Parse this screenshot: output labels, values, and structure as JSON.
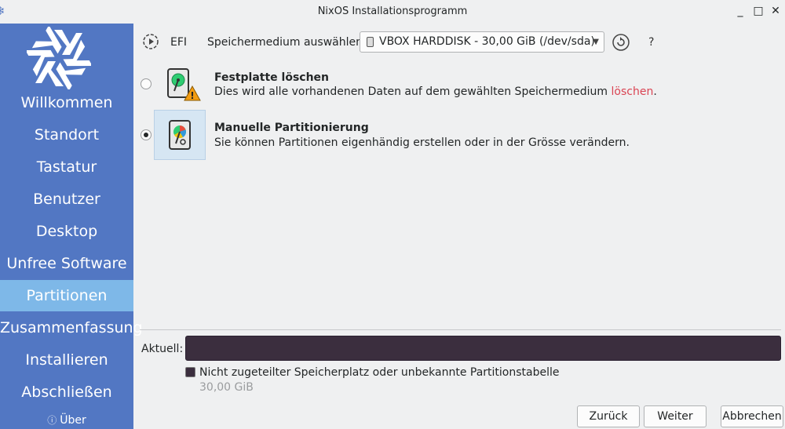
{
  "window": {
    "title": "NixOS Installationsprogramm",
    "minimize": "_",
    "maximize": "□",
    "close": "✕"
  },
  "sidebar": {
    "items": [
      {
        "label": "Willkommen",
        "active": false
      },
      {
        "label": "Standort",
        "active": false
      },
      {
        "label": "Tastatur",
        "active": false
      },
      {
        "label": "Benutzer",
        "active": false
      },
      {
        "label": "Desktop",
        "active": false
      },
      {
        "label": "Unfree Software",
        "active": false
      },
      {
        "label": "Partitionen",
        "active": true
      },
      {
        "label": "Zusammenfassung",
        "active": false
      },
      {
        "label": "Installieren",
        "active": false
      },
      {
        "label": "Abschließen",
        "active": false
      }
    ],
    "about": "Über",
    "colors": {
      "background": "#5277c3",
      "active": "#7eb8e8"
    }
  },
  "toolbar": {
    "efi_label": "EFI",
    "device_label": "Speichermedium auswählen",
    "device_value": "VBOX HARDDISK - 30,00 GiB (/dev/sda)",
    "help_label": "?"
  },
  "options": {
    "erase": {
      "title": "Festplatte löschen",
      "desc_before": "Dies wird alle vorhandenen Daten auf dem gewählten Speichermedium ",
      "desc_danger": "löschen",
      "desc_after": ".",
      "selected": false,
      "icon": "harddisk-warning-icon"
    },
    "manual": {
      "title": "Manuelle Partitionierung",
      "desc": "Sie können Partitionen eigenhändig erstellen oder in der Grösse verändern.",
      "selected": true,
      "icon": "harddisk-manual-partition-icon"
    }
  },
  "current": {
    "label": "Aktuell:",
    "bar_color": "#3b2e3e",
    "legend_text": "Nicht zugeteilter Speicherplatz oder unbekannte Partitionstabelle",
    "legend_size": "30,00 GiB"
  },
  "buttons": {
    "back": "Zurück",
    "next": "Weiter",
    "cancel": "Abbrechen"
  }
}
